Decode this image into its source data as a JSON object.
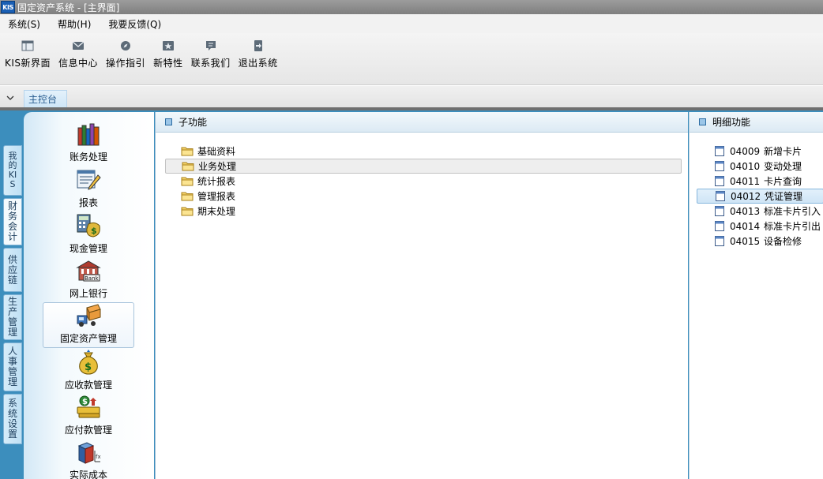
{
  "window": {
    "logo": "KIS",
    "title": "固定资产系统 - [主界面]"
  },
  "menu": [
    "系统(S)",
    "帮助(H)",
    "我要反馈(Q)"
  ],
  "toolbar": [
    {
      "label": "KIS新界面",
      "icon": "new-ui-icon"
    },
    {
      "label": "信息中心",
      "icon": "envelope-icon"
    },
    {
      "label": "操作指引",
      "icon": "compass-icon"
    },
    {
      "label": "新特性",
      "icon": "star-box-icon"
    },
    {
      "label": "联系我们",
      "icon": "chat-bubble-icon"
    },
    {
      "label": "退出系统",
      "icon": "exit-icon"
    }
  ],
  "tabstrip": {
    "active_tab": "主控台"
  },
  "side_tabs": [
    {
      "label": "我的KIS"
    },
    {
      "label": "财务会计"
    },
    {
      "label": "供应链"
    },
    {
      "label": "生产管理"
    },
    {
      "label": "人事管理"
    },
    {
      "label": "系统设置"
    }
  ],
  "modules": [
    {
      "label": "账务处理",
      "icon": "ledger-books-icon"
    },
    {
      "label": "报表",
      "icon": "report-pen-icon"
    },
    {
      "label": "现金管理",
      "icon": "cash-calculator-icon"
    },
    {
      "label": "网上银行",
      "icon": "bank-building-icon"
    },
    {
      "label": "固定资产管理",
      "icon": "fixed-asset-truck-icon"
    },
    {
      "label": "应收款管理",
      "icon": "money-bag-icon"
    },
    {
      "label": "应付款管理",
      "icon": "payable-money-icon"
    },
    {
      "label": "实际成本",
      "icon": "cost-chart-icon"
    }
  ],
  "sub_panel": {
    "title": "子功能",
    "items": [
      "基础资料",
      "业务处理",
      "统计报表",
      "管理报表",
      "期末处理"
    ]
  },
  "detail_panel": {
    "title": "明细功能",
    "items": [
      {
        "code": "04009",
        "label": "新增卡片"
      },
      {
        "code": "04010",
        "label": "变动处理"
      },
      {
        "code": "04011",
        "label": "卡片查询"
      },
      {
        "code": "04012",
        "label": "凭证管理"
      },
      {
        "code": "04013",
        "label": "标准卡片引入"
      },
      {
        "code": "04014",
        "label": "标准卡片引出"
      },
      {
        "code": "04015",
        "label": "设备检修"
      }
    ]
  },
  "colors": {
    "frame_blue": "#3c8ebd",
    "tab_text": "#2a5d8f",
    "selection": "#cfe5f6"
  }
}
